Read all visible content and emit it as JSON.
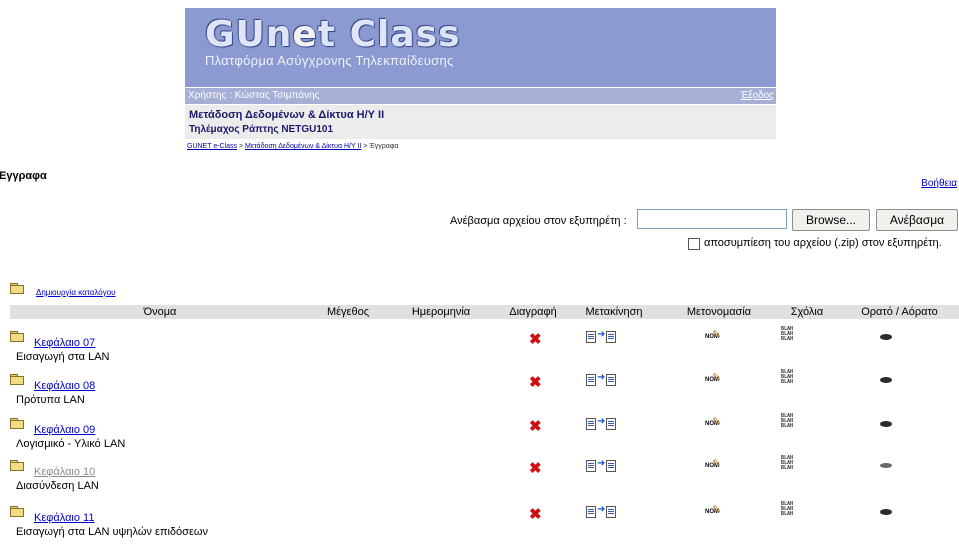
{
  "header": {
    "logo_main_a": "GUn",
    "logo_main_b": "e",
    "logo_main_c": "t Class",
    "logo_sub": "Πλατφόρμα Ασύγχρονης Τηλεκπαίδευσης",
    "user": "Χρήστης : Κώστας Τσιμπάνης",
    "logout": "Έξοδος",
    "course_title": "Μετάδοση Δεδομένων & Δίκτυα Η/Υ ΙΙ",
    "course_sub": "Τηλέμαχος Ράπτης NETGU101"
  },
  "breadcrumb": {
    "home": "GUNET e-Class",
    "sep": " > ",
    "course": "Μετάδοση Δεδομένων & Δίκτυα Η/Υ ΙΙ",
    "current": "Έγγραφα"
  },
  "page": {
    "title": "Έγγραφα",
    "help": "Βοήθεια"
  },
  "upload": {
    "label": "Ανέβασμα αρχείου στον εξυπηρέτη :",
    "file_value": "",
    "browse": "Browse...",
    "submit": "Ανέβασμα",
    "unzip_label": "αποσυμπίεση του αρχείου (.zip) στον εξυπηρέτη."
  },
  "create_dir": "Δημιουργία καταλόγου",
  "table": {
    "headers": [
      "Όνομα",
      "Μέγεθος",
      "Ημερομηνία",
      "Διαγραφή",
      "Μετακίνηση",
      "Μετονομασία",
      "Σχόλια",
      "Ορατό / Αόρατο"
    ],
    "rows": [
      {
        "name": "Κεφάλαιο 07",
        "description": "Εισαγωγή στα LAN",
        "visible": true
      },
      {
        "name": "Κεφάλαιο 08",
        "description": "Πρότυπα LAN",
        "visible": true
      },
      {
        "name": "Κεφάλαιο 09",
        "description": "Λογισμικό - Υλικό LAN",
        "visible": true
      },
      {
        "name": "Κεφάλαιο 10",
        "description": "Διασύνδεση LAN",
        "visible": false
      },
      {
        "name": "Κεφάλαιο 11",
        "description": "Εισαγωγή στα LAN υψηλών επιδόσεων",
        "visible": true
      }
    ],
    "icons": {
      "delete": "✖",
      "rename_text": "NOM",
      "rename_pen": "✎",
      "comment_text": "BLAH",
      "move_arrow": "➜"
    }
  },
  "colors": {
    "banner": "#8b9ad0",
    "userbar": "#a6b0d6",
    "link": "#0000cc",
    "delete": "#d01010"
  }
}
